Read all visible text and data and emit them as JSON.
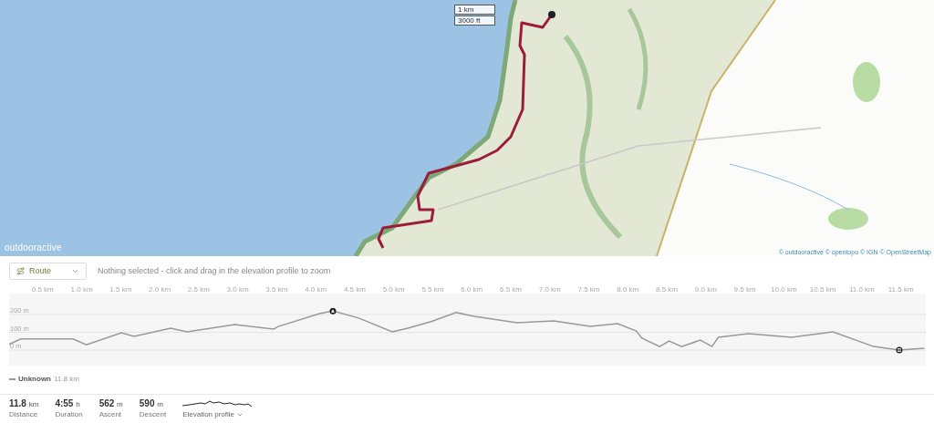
{
  "map": {
    "kind": "picture",
    "scale": [
      "1 km",
      "3000 ft"
    ],
    "logo": "outdooractive",
    "attribution": "© outdooractive © opentopo © IGN © OpenStreetMap"
  },
  "toolbar": {
    "dropdown": {
      "label": "Route"
    },
    "hint": "Nothing selected - click and drag in the elevation profile to zoom"
  },
  "elevation": {
    "chart_data": {
      "type": "line",
      "xlim": [
        0.07,
        11.82
      ],
      "ylim": [
        -87,
        313
      ],
      "grid": true,
      "xticks": [
        {
          "value": 0.5,
          "label": "0.5 km"
        },
        {
          "value": 1,
          "label": "1.0 km"
        },
        {
          "value": 1.5,
          "label": "1.5 km"
        },
        {
          "value": 2,
          "label": "2.0 km"
        },
        {
          "value": 2.5,
          "label": "2.5 km"
        },
        {
          "value": 3,
          "label": "3.0 km"
        },
        {
          "value": 3.5,
          "label": "3.5 km"
        },
        {
          "value": 4,
          "label": "4.0 km"
        },
        {
          "value": 4.5,
          "label": "4.5 km"
        },
        {
          "value": 5,
          "label": "5.0 km"
        },
        {
          "value": 5.5,
          "label": "5.5 km"
        },
        {
          "value": 6,
          "label": "6.0 km"
        },
        {
          "value": 6.5,
          "label": "6.5 km"
        },
        {
          "value": 7,
          "label": "7.0 km"
        },
        {
          "value": 7.5,
          "label": "7.5 km"
        },
        {
          "value": 8,
          "label": "8.0 km"
        },
        {
          "value": 8.5,
          "label": "8.5 km"
        },
        {
          "value": 9,
          "label": "9.0 km"
        },
        {
          "value": 9.5,
          "label": "9.5 km"
        },
        {
          "value": 10,
          "label": "10.0 km"
        },
        {
          "value": 10.5,
          "label": "10.5 km"
        },
        {
          "value": 11,
          "label": "11.0 km"
        },
        {
          "value": 11.5,
          "label": "11.5 km"
        }
      ],
      "yticks": [
        {
          "value": 0,
          "label": "0 m"
        },
        {
          "value": 100,
          "label": "100 m"
        },
        {
          "value": 200,
          "label": "200 m"
        }
      ],
      "x": [
        0.07,
        0.22,
        0.89,
        1.06,
        1.51,
        1.67,
        2.14,
        2.35,
        2.96,
        3.46,
        3.52,
        4.05,
        4.22,
        4.55,
        4.98,
        5.18,
        5.48,
        5.8,
        6.03,
        6.19,
        6.58,
        7.05,
        7.52,
        7.87,
        8.11,
        8.18,
        8.41,
        8.53,
        8.69,
        8.93,
        9.08,
        9.16,
        9.55,
        10.1,
        10.63,
        11.15,
        11.48,
        11.8
      ],
      "series": [
        {
          "name": "Unknown",
          "color": "#999999",
          "values": [
            32,
            63,
            63,
            30,
            97,
            77,
            123,
            102,
            143,
            118,
            133,
            205,
            220,
            180,
            103,
            123,
            160,
            212,
            190,
            180,
            154,
            164,
            133,
            149,
            108,
            67,
            20,
            51,
            20,
            56,
            20,
            72,
            92,
            72,
            103,
            20,
            0,
            10
          ]
        }
      ]
    }
  },
  "legend": {
    "value": "11.8 km"
  },
  "stats": [
    {
      "value": "11.8",
      "unit": "km",
      "label": "Distance"
    },
    {
      "value": "4:55",
      "unit": "h",
      "label": "Duration"
    },
    {
      "value": "562",
      "unit": "m",
      "label": "Ascent"
    },
    {
      "value": "590",
      "unit": "m",
      "label": "Descent"
    }
  ],
  "profile_toggle": {
    "label": "Elevation profile"
  }
}
